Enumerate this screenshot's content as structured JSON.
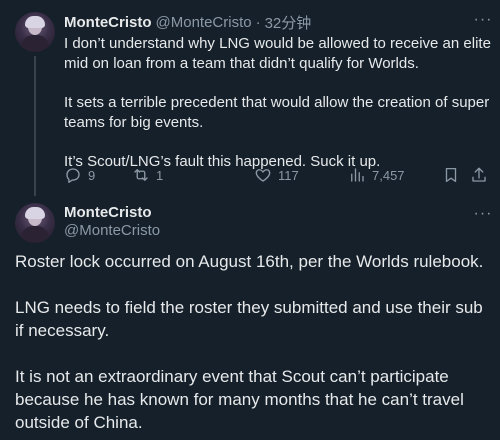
{
  "reply_tweet": {
    "display_name": "MonteCristo",
    "handle": "@MonteCristo",
    "separator": "·",
    "time": "32分钟",
    "paragraphs": [
      "I don’t understand why LNG would be allowed to receive an elite mid on loan from a team that didn’t qualify for Worlds.",
      "It sets a terrible precedent that would allow the creation of super teams for big events.",
      "It’s Scout/LNG’s fault this happened. Suck it up."
    ],
    "actions": {
      "replies": "9",
      "retweets": "1",
      "likes": "117",
      "views": "7,457"
    },
    "icons": [
      "reply-icon",
      "retweet-icon",
      "like-icon",
      "views-icon",
      "bookmark-icon",
      "share-icon",
      "more-icon"
    ]
  },
  "main_tweet": {
    "display_name": "MonteCristo",
    "handle": "@MonteCristo",
    "paragraphs": [
      "Roster lock occurred on August 16th, per the Worlds rulebook.",
      "LNG needs to field the roster they submitted and use their sub if necessary.",
      "It is not an extraordinary event that Scout can’t participate because he has known for many months that he can’t travel outside of China."
    ]
  },
  "colors": {
    "background": "#15202b",
    "text": "#e7e9ea",
    "secondary": "#8b98a5",
    "thread_line": "#38444d"
  }
}
